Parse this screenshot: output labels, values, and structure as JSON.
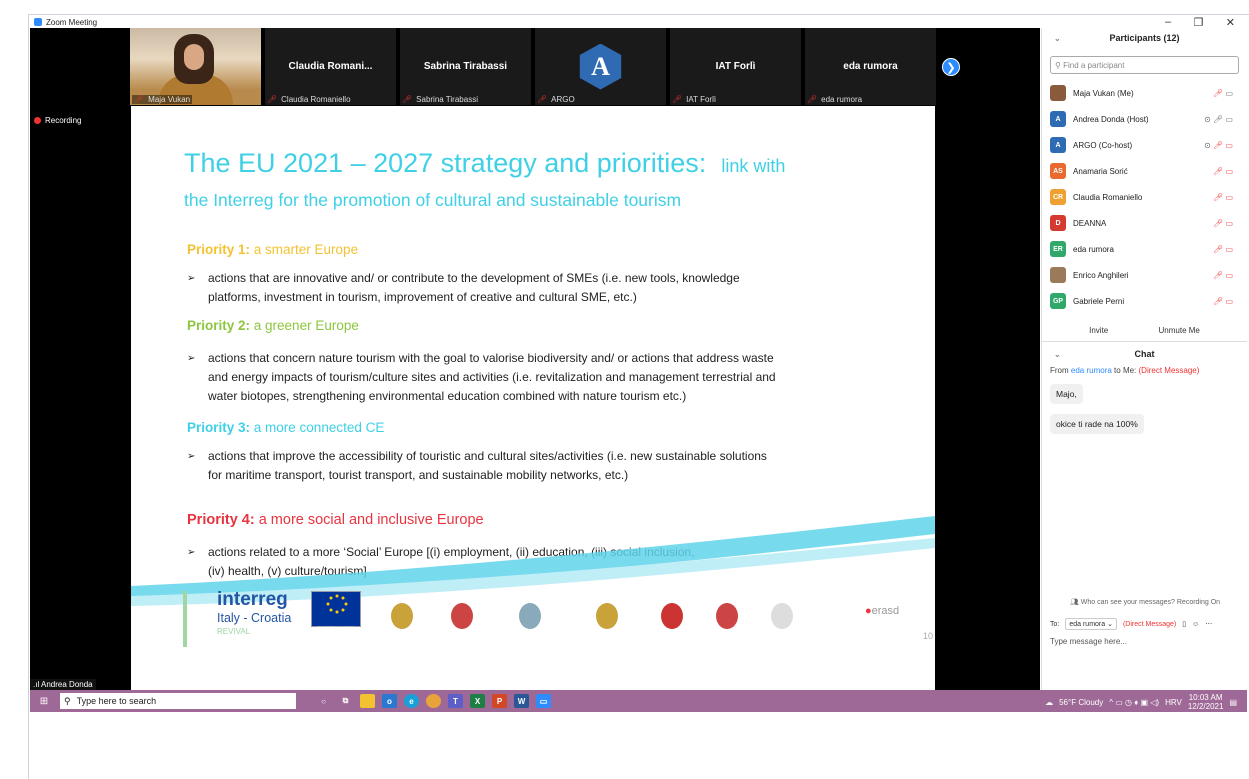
{
  "window": {
    "title": "Zoom Meeting",
    "minimize": "–",
    "maximize": "❐",
    "close": "✕"
  },
  "gallery": {
    "tiles": [
      {
        "display": "",
        "label": "Maja Vukan"
      },
      {
        "display": "Claudia Romani...",
        "label": "Claudia Romaniello"
      },
      {
        "display": "Sabrina Tirabassi",
        "label": "Sabrina Tirabassi"
      },
      {
        "display": "A",
        "label": "ARGO"
      },
      {
        "display": "IAT Forlì",
        "label": "IAT Forlì"
      },
      {
        "display": "eda rumora",
        "label": "eda rumora"
      }
    ],
    "next": "❯"
  },
  "recording": "Recording",
  "slide": {
    "title_main": "The EU 2021 – 2027 strategy and priorities:",
    "title_link": "link with",
    "title_line2": "the Interreg for the promotion of cultural and sustainable tourism",
    "priorities": [
      {
        "label": "Priority 1:",
        "rest": " a smarter Europe",
        "color": "#f2c230",
        "lines": [
          "actions that are innovative and/ or contribute to the development of  SMEs (i.e. new tools, knowledge",
          "platforms, investment in tourism, improvement of creative and cultural SME, etc.)"
        ]
      },
      {
        "label": "Priority 2:",
        "rest": " a greener Europe",
        "color": "#8dc63f",
        "lines": [
          "actions that concern nature tourism with the goal to valorise biodiversity and/ or actions that address waste",
          "and energy impacts of tourism/culture sites and activities (i.e. revitalization and management terrestrial and",
          "water biotopes, strengthening environmental education combined with nature tourism etc.)"
        ]
      },
      {
        "label": "Priority 3:",
        "rest": " a more connected CE",
        "color": "#3fd0e6",
        "lines": [
          "actions that improve the accessibility of touristic and cultural sites/activities (i.e. new sustainable solutions",
          "for maritime transport, tourist transport,  and sustainable mobility networks, etc.)"
        ]
      },
      {
        "label": "Priority 4:",
        "rest": " a more social and inclusive Europe",
        "color": "#e8343f",
        "lines": [
          "actions related to a more ‘Social’ Europe [(i) employment, (ii) education, (iii) social inclusion,",
          "(iv) health, (v) culture/tourism]"
        ]
      }
    ],
    "logo_interreg": "interreg",
    "logo_country": "Italy - Croatia",
    "logo_sub": "REVIVAL",
    "logo_eu": "EUROPEAN UNION",
    "logo_erasd": "erasd",
    "page_number": "10"
  },
  "speaker_label": "Andrea Donda",
  "participants": {
    "header": "Participants (12)",
    "search_placeholder": "Find a participant",
    "list": [
      {
        "name": "Maja Vukan (Me)",
        "initials": "",
        "color": "#8a5a3c"
      },
      {
        "name": "Andrea Donda (Host)",
        "initials": "A",
        "color": "#2f6bb3"
      },
      {
        "name": "ARGO (Co-host)",
        "initials": "A",
        "color": "#2f6bb3"
      },
      {
        "name": "Anamaria Sorić",
        "initials": "AS",
        "color": "#e86a2e"
      },
      {
        "name": "Claudia Romaniello",
        "initials": "CR",
        "color": "#f0a030"
      },
      {
        "name": "DEANNA",
        "initials": "D",
        "color": "#d43a2f"
      },
      {
        "name": "eda rumora",
        "initials": "ER",
        "color": "#2fa86a"
      },
      {
        "name": "Enrico Anghileri",
        "initials": "",
        "color": "#9a7a5a"
      },
      {
        "name": "Gabriele Perni",
        "initials": "GP",
        "color": "#2fa86a"
      }
    ],
    "invite": "Invite",
    "unmute": "Unmute Me"
  },
  "chat": {
    "header": "Chat",
    "from_prefix": "From",
    "from_name": "eda rumora",
    "from_mid": " to Me:",
    "from_dm": " (Direct Message)",
    "messages": [
      "Majo,",
      "okice ti rade na 100%"
    ],
    "who_can_see": "Who can see your messages? Recording On",
    "to_label": "To:",
    "to_value": "eda rumora ⌄",
    "to_dm": "(Direct Message)",
    "input_placeholder": "Type message here..."
  },
  "taskbar": {
    "search": "Type here to search",
    "weather": "56°F  Cloudy",
    "lang": "HRV",
    "time": "10:03 AM",
    "date": "12/2/2021"
  }
}
